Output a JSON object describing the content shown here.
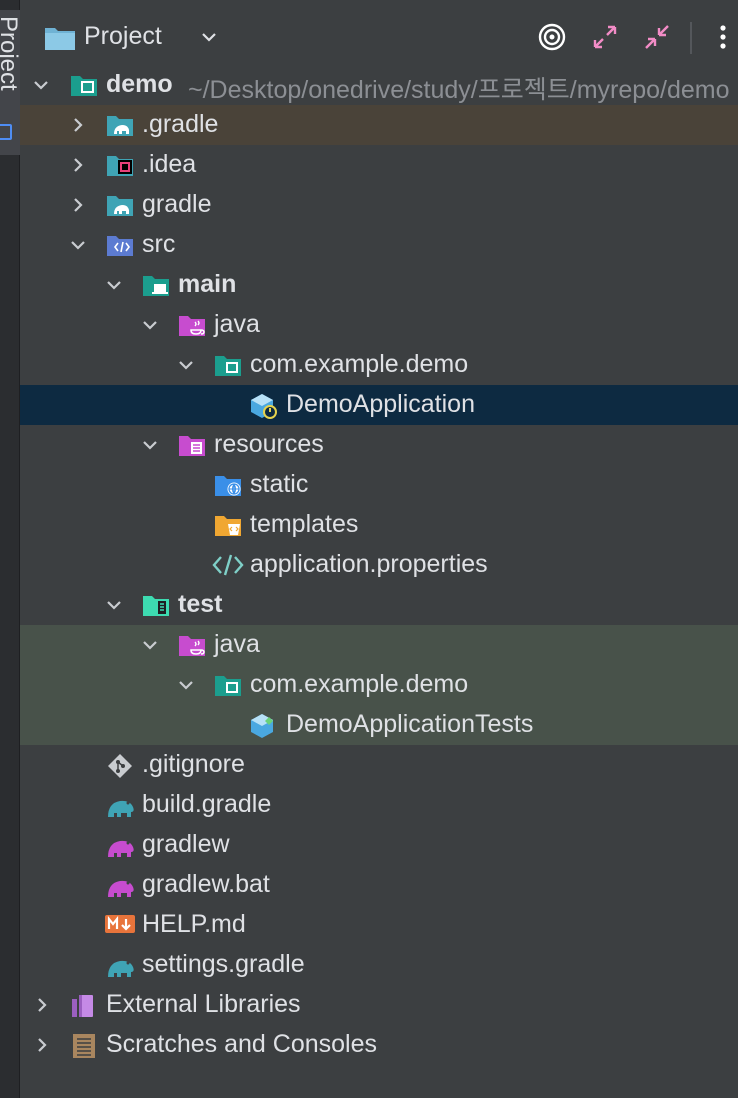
{
  "stripe": {
    "label": "Project"
  },
  "header": {
    "title": "Project",
    "buttons": [
      "target-icon",
      "expand-icon",
      "collapse-icon",
      "more-icon"
    ]
  },
  "tree": {
    "root": {
      "name": "demo",
      "path": "~/Desktop/onedrive/study/프로젝트/myrepo/demo"
    },
    "items": {
      "gradle_dir": ".gradle",
      "idea": ".idea",
      "gradle": "gradle",
      "src": "src",
      "main": "main",
      "main_java": "java",
      "main_package": "com.example.demo",
      "demo_application": "DemoApplication",
      "resources": "resources",
      "static": "static",
      "templates": "templates",
      "application_properties": "application.properties",
      "test": "test",
      "test_java": "java",
      "test_package": "com.example.demo",
      "demo_application_tests": "DemoApplicationTests",
      "gitignore": ".gitignore",
      "build_gradle": "build.gradle",
      "gradlew": "gradlew",
      "gradlew_bat": "gradlew.bat",
      "help_md": "HELP.md",
      "settings_gradle": "settings.gradle",
      "external_libraries": "External Libraries",
      "scratches": "Scratches and Consoles"
    }
  },
  "colors": {
    "background": "#3c3f41",
    "selection": "#0d2a41",
    "test_highlight": "#48524a",
    "excluded_highlight": "#4a4339",
    "source_folder": "#c74ccf",
    "module_teal": "#1b9e8e",
    "gradle_teal": "#3fa4b5"
  }
}
